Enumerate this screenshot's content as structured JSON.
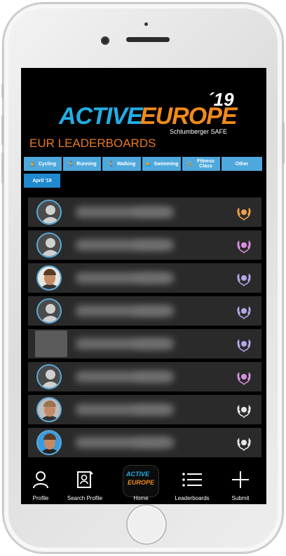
{
  "app": {
    "logo_active": "ACTIVE",
    "logo_europe": "EUROPE",
    "logo_year": "´19",
    "logo_sub": "Schlumberger SAFE",
    "heading": "EUR LEADERBOARDS"
  },
  "tabs": [
    {
      "label": "Cycling",
      "icon": "bike-icon",
      "glyph": "🚴"
    },
    {
      "label": "Running",
      "icon": "run-icon",
      "glyph": "🏃"
    },
    {
      "label": "Walking",
      "icon": "walk-icon",
      "glyph": "🚶"
    },
    {
      "label": "Swimming",
      "icon": "swim-icon",
      "glyph": "🏊"
    },
    {
      "label": "Fitness Class",
      "icon": "fitness-icon",
      "glyph": "🤸"
    },
    {
      "label": "Other",
      "icon": "",
      "glyph": ""
    }
  ],
  "month": "April '19",
  "rows": [
    {
      "avatar": "placeholder",
      "badge_color": "#f0a046"
    },
    {
      "avatar": "placeholder",
      "badge_color": "#d98fe0"
    },
    {
      "avatar": "photo",
      "badge_color": "#b7a6e8"
    },
    {
      "avatar": "placeholder",
      "badge_color": "#b7a6e8"
    },
    {
      "avatar": "square",
      "badge_color": "#b7a6e8"
    },
    {
      "avatar": "placeholder",
      "badge_color": "#d98fe0"
    },
    {
      "avatar": "photo-grey",
      "badge_color": "#e6e6e6"
    },
    {
      "avatar": "photo-blue",
      "badge_color": "#e6e6e6"
    }
  ],
  "nav": {
    "profile": "Profile",
    "search_profile": "Search Profile",
    "home": "Home",
    "leaderboards": "Leaderboards",
    "submit": "Submit",
    "home_logo_active": "ACTIVE",
    "home_logo_europe": "EUROPE"
  },
  "colors": {
    "accent_blue": "#4fa8dc",
    "accent_orange": "#e8791e",
    "background": "#000000"
  }
}
